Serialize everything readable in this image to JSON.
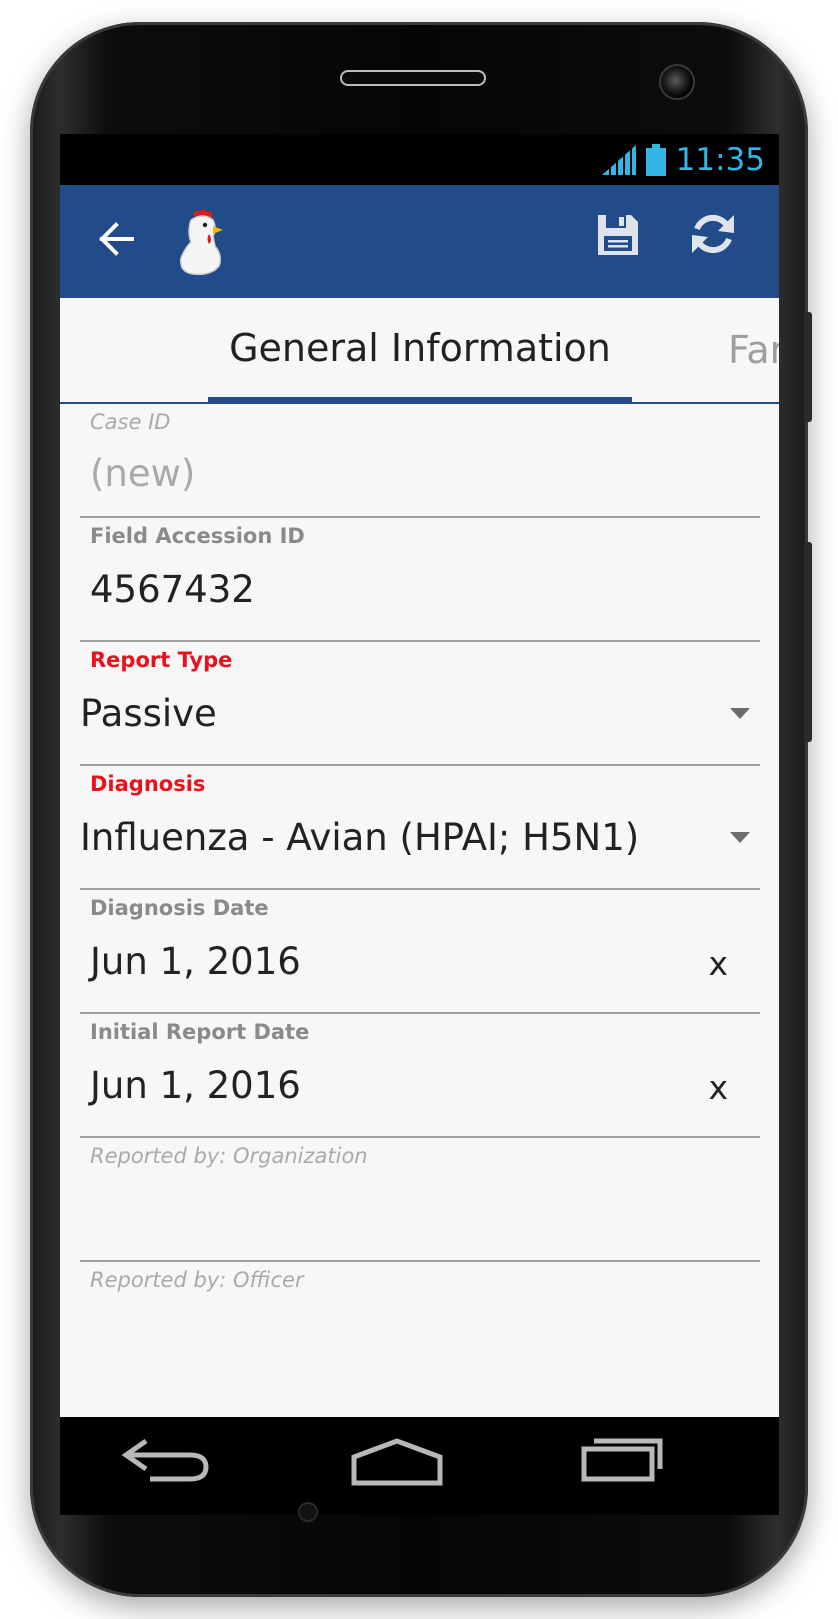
{
  "status_bar": {
    "time": "11:35",
    "signal_icon": "signal-icon",
    "battery_icon": "battery-icon"
  },
  "app_bar": {
    "back_icon": "arrow-back-icon",
    "logo": "chicken-logo-icon",
    "save_icon": "save-icon",
    "sync_icon": "sync-icon",
    "color": "#214b89"
  },
  "tabs": [
    {
      "label": "General Information",
      "active": true
    },
    {
      "label": "Far",
      "active": false
    }
  ],
  "form": {
    "case_id": {
      "label": "Case ID",
      "value": "(new)"
    },
    "field_accession_id": {
      "label": "Field Accession ID",
      "value": "4567432"
    },
    "report_type": {
      "label": "Report Type",
      "value": "Passive"
    },
    "diagnosis": {
      "label": "Diagnosis",
      "value": "Influenza - Avian (HPAI; H5N1)"
    },
    "diagnosis_date": {
      "label": "Diagnosis Date",
      "value": "Jun 1, 2016",
      "clear": "x"
    },
    "initial_report_date": {
      "label": "Initial Report Date",
      "value": "Jun 1, 2016",
      "clear": "x"
    },
    "reported_by_org": {
      "label": "Reported by: Organization",
      "value": ""
    },
    "reported_by_officer": {
      "label": "Reported by: Officer",
      "value": ""
    }
  },
  "nav_bar": {
    "back": "nav-back-icon",
    "home": "nav-home-icon",
    "recents": "nav-recents-icon"
  },
  "colors": {
    "required_label": "#e8121e",
    "accent": "#33b5e5"
  }
}
